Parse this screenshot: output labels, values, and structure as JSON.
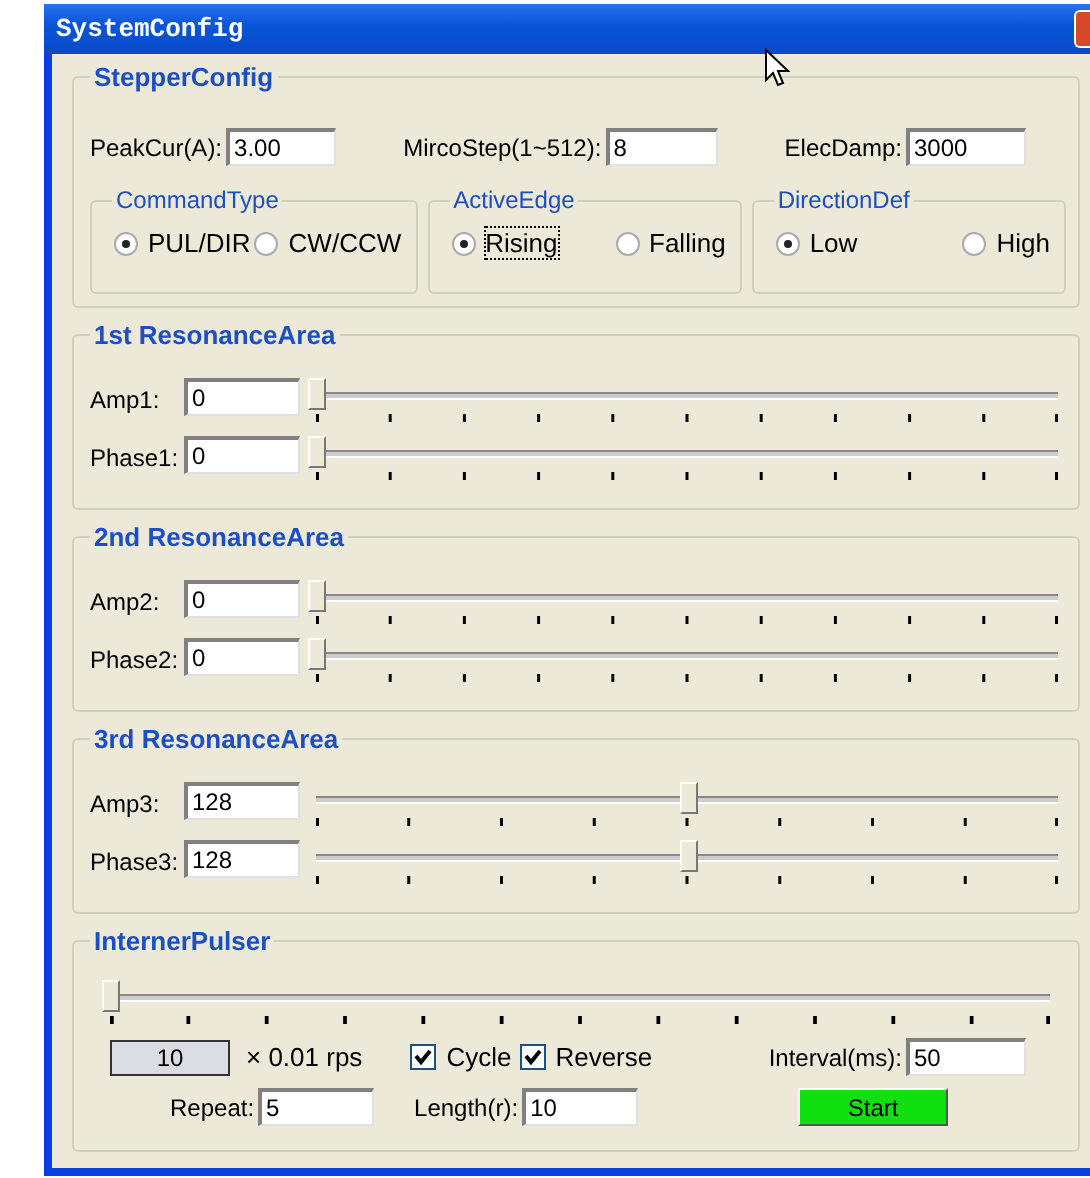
{
  "window": {
    "title": "SystemConfig"
  },
  "stepper_config": {
    "title": "StepperConfig",
    "fields": [
      {
        "label": "PeakCur(A):",
        "value": "3.00"
      },
      {
        "label": "MircoStep(1~512):",
        "value": "8"
      },
      {
        "label": "ElecDamp:",
        "value": "3000"
      }
    ],
    "option_groups": [
      {
        "title": "CommandType",
        "options": [
          {
            "label": "PUL/DIR",
            "selected": true,
            "focused": false
          },
          {
            "label": "CW/CCW",
            "selected": false,
            "focused": false
          }
        ]
      },
      {
        "title": "ActiveEdge",
        "options": [
          {
            "label": "Rising",
            "selected": true,
            "focused": true
          },
          {
            "label": "Falling",
            "selected": false,
            "focused": false
          }
        ]
      },
      {
        "title": "DirectionDef",
        "options": [
          {
            "label": "Low",
            "selected": true,
            "focused": false
          },
          {
            "label": "High",
            "selected": false,
            "focused": false
          }
        ]
      }
    ]
  },
  "resonance_areas": [
    {
      "title": "1st ResonanceArea",
      "sliders": [
        {
          "label": "Amp1:",
          "value": "0",
          "level": 0,
          "kind": "ticks11"
        },
        {
          "label": "Phase1:",
          "value": "0",
          "level": 0,
          "kind": "ticks11"
        }
      ]
    },
    {
      "title": "2nd ResonanceArea",
      "sliders": [
        {
          "label": "Amp2:",
          "value": "0",
          "level": 0,
          "kind": "ticks11"
        },
        {
          "label": "Phase2:",
          "value": "0",
          "level": 0,
          "kind": "ticks11"
        }
      ]
    },
    {
      "title": "3rd ResonanceArea",
      "sliders": [
        {
          "label": "Amp3:",
          "value": "128",
          "level": 0.5,
          "kind": "ticks9"
        },
        {
          "label": "Phase3:",
          "value": "128",
          "level": 0.5,
          "kind": "ticks9"
        }
      ]
    }
  ],
  "interner_pulser": {
    "title": "InternerPulser",
    "speed_slider": {
      "level": 0,
      "kind": "ticks13"
    },
    "speed_readout": "10",
    "speed_unit": "× 0.01 rps",
    "checkboxes": [
      {
        "label": "Cycle",
        "checked": true
      },
      {
        "label": "Reverse",
        "checked": true
      }
    ],
    "interval": {
      "label": "Interval(ms):",
      "value": "50"
    },
    "repeat": {
      "label": "Repeat:",
      "value": "5"
    },
    "length": {
      "label": "Length(r):",
      "value": "10"
    },
    "start_button": "Start"
  }
}
